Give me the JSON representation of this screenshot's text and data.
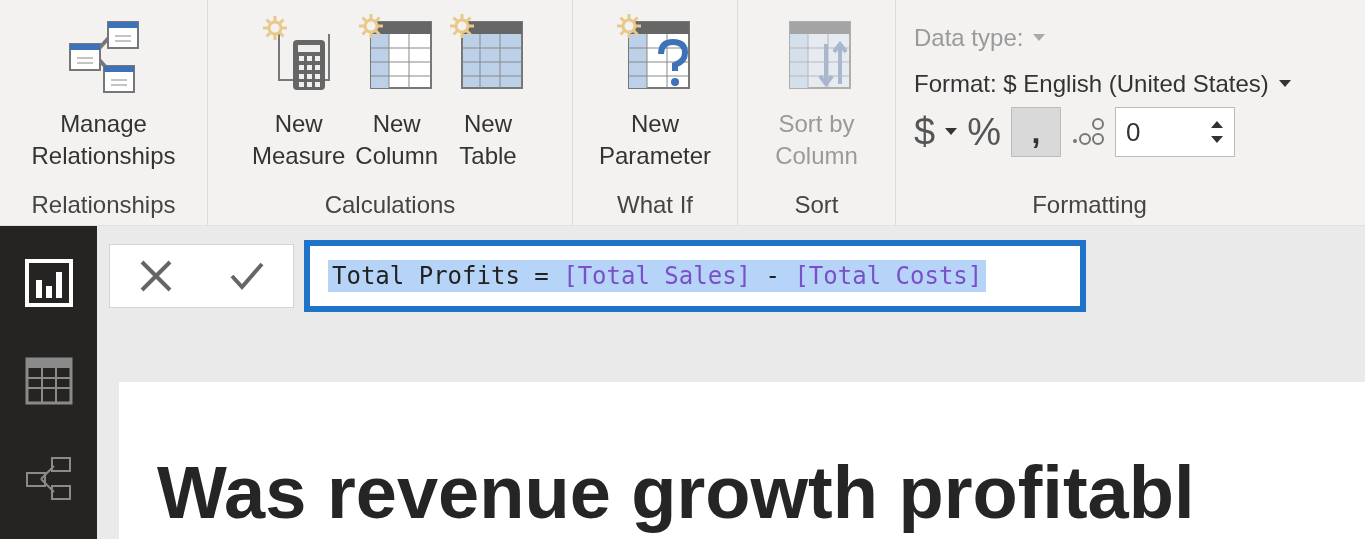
{
  "ribbon": {
    "groups": [
      {
        "label": "Relationships",
        "buttons": [
          {
            "kind": "relationships",
            "label": [
              "Manage",
              "Relationships"
            ],
            "disabled": false
          }
        ]
      },
      {
        "label": "Calculations",
        "buttons": [
          {
            "kind": "measure",
            "label": [
              "New",
              "Measure"
            ],
            "disabled": false
          },
          {
            "kind": "column",
            "label": [
              "New",
              "Column"
            ],
            "disabled": false
          },
          {
            "kind": "table",
            "label": [
              "New",
              "Table"
            ],
            "disabled": false
          }
        ]
      },
      {
        "label": "What If",
        "buttons": [
          {
            "kind": "parameter",
            "label": [
              "New",
              "Parameter"
            ],
            "disabled": false
          }
        ]
      },
      {
        "label": "Sort",
        "buttons": [
          {
            "kind": "sort",
            "label": [
              "Sort by",
              "Column"
            ],
            "disabled": true
          }
        ]
      }
    ],
    "formatting": {
      "label": "Formatting",
      "data_type": {
        "label": "Data type:",
        "disabled": true
      },
      "format": {
        "label": "Format: $ English (United States)"
      },
      "currency": "$",
      "percent": "%",
      "comma": {
        "label": ",",
        "on": true
      },
      "decimals": {
        "value": "0"
      }
    }
  },
  "sidebar": {
    "items": [
      {
        "kind": "report",
        "selected": true
      },
      {
        "kind": "data",
        "selected": false
      },
      {
        "kind": "model",
        "selected": false
      }
    ]
  },
  "formula_bar": {
    "tokens": [
      {
        "kind": "plain",
        "text": "Total Profits = "
      },
      {
        "kind": "column",
        "text": "[Total Sales]"
      },
      {
        "kind": "plain",
        "text": " - "
      },
      {
        "kind": "column",
        "text": "[Total Costs]"
      }
    ],
    "selected": true,
    "highlighted": true
  },
  "canvas": {
    "title": "Was revenue growth profitabl"
  }
}
